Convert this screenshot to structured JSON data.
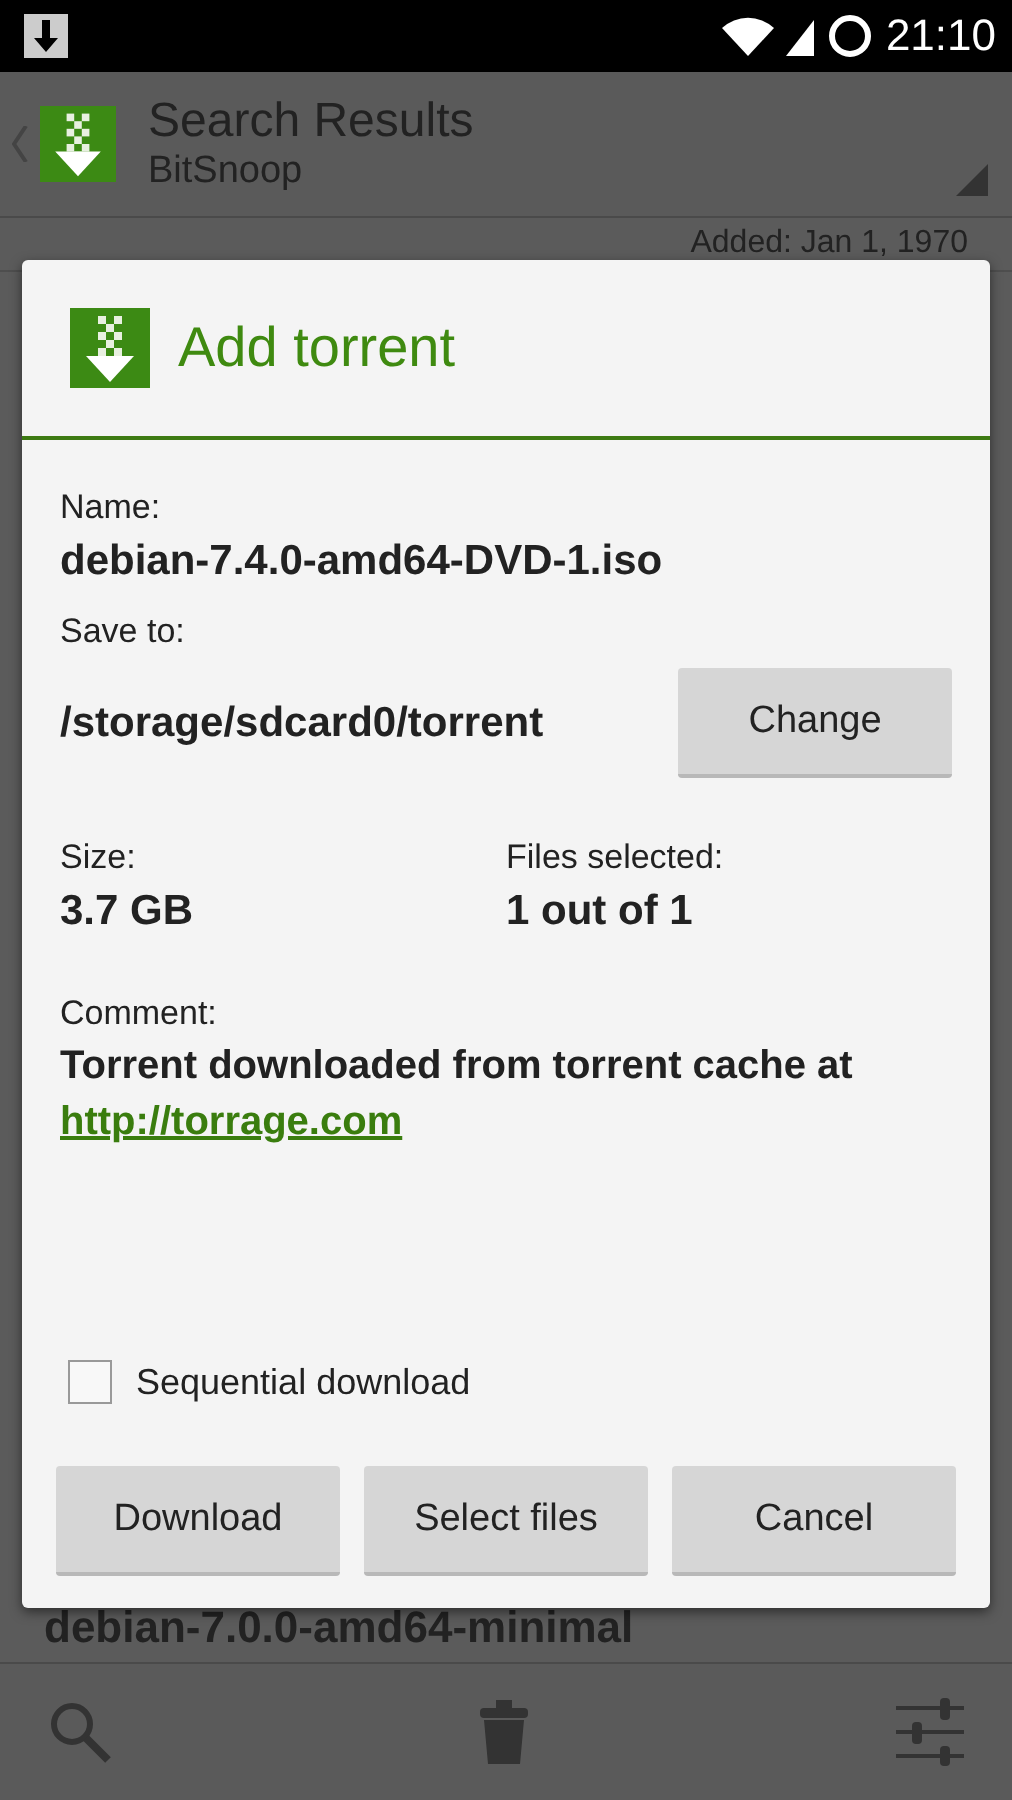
{
  "status_bar": {
    "time": "21:10"
  },
  "action_bar": {
    "title": "Search Results",
    "subtitle": "BitSnoop"
  },
  "results": [
    {
      "added": "Added: Jan 1, 1970"
    },
    {
      "name": "debian-7.0.0-amd64-minimal"
    }
  ],
  "dialog": {
    "title": "Add torrent",
    "name_label": "Name:",
    "name": "debian-7.4.0-amd64-DVD-1.iso",
    "save_label": "Save to:",
    "save_path": "/storage/sdcard0/torrent",
    "change_button": "Change",
    "size_label": "Size:",
    "size": "3.7 GB",
    "files_label": "Files selected:",
    "files": "1 out of 1",
    "comment_label": "Comment:",
    "comment": "Torrent downloaded from torrent cache at",
    "link": "http://torrage.com",
    "sequential": {
      "label": "Sequential download",
      "checked": false
    },
    "buttons": [
      "Download",
      "Select files",
      "Cancel"
    ]
  }
}
